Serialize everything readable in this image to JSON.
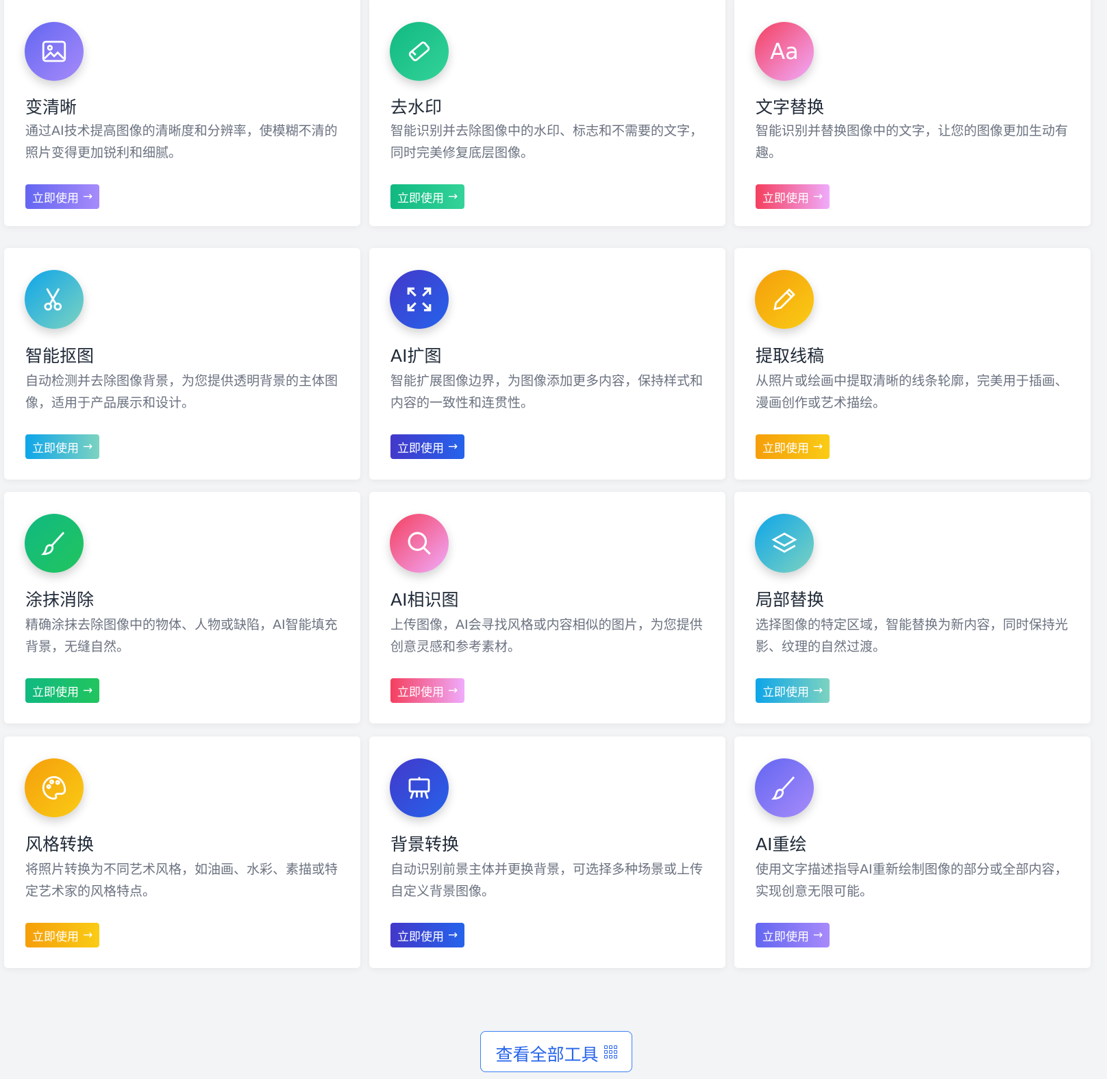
{
  "button_label": "立即使用",
  "arrow": "→",
  "view_all": {
    "label": "查看全部工具"
  },
  "tools": [
    {
      "title": "变清晰",
      "desc": "通过AI技术提高图像的清晰度和分辨率，使模糊不清的照片变得更加锐利和细腻。",
      "icon": "image-icon",
      "gradient": [
        "#6366f1",
        "#a78bfa"
      ]
    },
    {
      "title": "去水印",
      "desc": "智能识别并去除图像中的水印、标志和不需要的文字，同时完美修复底层图像。",
      "icon": "eraser-icon",
      "gradient": [
        "#10b981",
        "#34d399"
      ]
    },
    {
      "title": "文字替换",
      "desc": "智能识别并替换图像中的文字，让您的图像更加生动有趣。",
      "icon": "text-icon",
      "icon_text": "Aa",
      "gradient": [
        "#f43f5e",
        "#f0abfc"
      ]
    },
    {
      "title": "智能抠图",
      "desc": "自动检测并去除图像背景，为您提供透明背景的主体图像，适用于产品展示和设计。",
      "icon": "scissors-icon",
      "gradient": [
        "#0ea5e9",
        "#7dd3c0"
      ]
    },
    {
      "title": "AI扩图",
      "desc": "智能扩展图像边界，为图像添加更多内容，保持样式和内容的一致性和连贯性。",
      "icon": "expand-icon",
      "gradient": [
        "#4338ca",
        "#2563eb"
      ]
    },
    {
      "title": "提取线稿",
      "desc": "从照片或绘画中提取清晰的线条轮廓，完美用于插画、漫画创作或艺术描绘。",
      "icon": "pencil-icon",
      "gradient": [
        "#f59e0b",
        "#facc15"
      ]
    },
    {
      "title": "涂抹消除",
      "desc": "精确涂抹去除图像中的物体、人物或缺陷，AI智能填充背景，无缝自然。",
      "icon": "brush-icon",
      "gradient": [
        "#10b981",
        "#22c55e"
      ]
    },
    {
      "title": "AI相识图",
      "desc": "上传图像，AI会寻找风格或内容相似的图片，为您提供创意灵感和参考素材。",
      "icon": "search-icon",
      "gradient": [
        "#f43f5e",
        "#f0abfc"
      ]
    },
    {
      "title": "局部替换",
      "desc": "选择图像的特定区域，智能替换为新内容，同时保持光影、纹理的自然过渡。",
      "icon": "layers-icon",
      "gradient": [
        "#0ea5e9",
        "#7dd3c0"
      ]
    },
    {
      "title": "风格转换",
      "desc": "将照片转换为不同艺术风格，如油画、水彩、素描或特定艺术家的风格特点。",
      "icon": "palette-icon",
      "gradient": [
        "#f59e0b",
        "#facc15"
      ]
    },
    {
      "title": "背景转换",
      "desc": "自动识别前景主体并更换背景，可选择多种场景或上传自定义背景图像。",
      "icon": "easel-icon",
      "gradient": [
        "#4338ca",
        "#2563eb"
      ]
    },
    {
      "title": "AI重绘",
      "desc": "使用文字描述指导AI重新绘制图像的部分或全部内容，实现创意无限可能。",
      "icon": "paintbrush-icon",
      "gradient": [
        "#6366f1",
        "#a78bfa"
      ]
    }
  ]
}
